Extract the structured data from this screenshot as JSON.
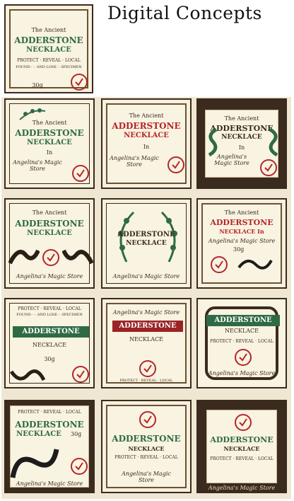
{
  "header": {
    "title": "Digital Concepts"
  },
  "colors": {
    "green": "#2e6b45",
    "red": "#b3262a",
    "dark": "#3a2b1e",
    "paper": "#f7f0dc"
  },
  "sample": {
    "line1": "The Ancient",
    "line2": "ADDERSTONE",
    "line3": "NECKLACE",
    "line4": "PROTECT · REVEAL · LOCAL",
    "line5": "FOUND·· ·· AND LOSE ·· SPECIMEN",
    "weight": "30g"
  },
  "labels": [
    {
      "top": "The Ancient",
      "name": "ADDERSTONE",
      "sub": "NECKLACE",
      "in": "In",
      "maker": "Angelina's Magic Store"
    },
    {
      "top": "The Ancient",
      "name": "ADDERSTONE",
      "sub": "NECKLACE",
      "in": "In",
      "maker": "Angelina's Magic Store"
    },
    {
      "top": "The Ancient",
      "name": "ADDERSTONE",
      "sub": "NECKLACE",
      "in": "In",
      "maker": "Angelina's Magic Store"
    },
    {
      "top": "The Ancient",
      "name": "ADDERSTONE",
      "sub": "NECKLACE",
      "maker": "Angelina's Magic Store"
    },
    {
      "name": "ADDERSTONE",
      "sub": "NECKLACE",
      "maker": "Angelina's Magic Store"
    },
    {
      "top": "The Ancient",
      "name": "ADDERSTONE",
      "sub": "NECKLACE In",
      "maker": "Angelina's Magic Store",
      "weight": "30g"
    },
    {
      "top": "PROTECT · REVEAL · LOCAL",
      "top2": "FOUND·· ·· AND LOSE ·· SPECIMEN",
      "name": "ADDERSTONE",
      "sub": "NECKLACE",
      "weight": "30g"
    },
    {
      "top": "Angelina's Magic Store",
      "name": "ADDERSTONE",
      "sub": "NECKLACE",
      "bottom": "PROTECT · REVEAL · LOCAL"
    },
    {
      "name": "ADDERSTONE",
      "sub": "NECKLACE",
      "bottom": "PROTECT · REVEAL · LOCAL",
      "maker": "Angelina's Magic Store"
    },
    {
      "top": "PROTECT · REVEAL · LOCAL",
      "name": "ADDERSTONE",
      "sub": "NECKLACE",
      "weight": "30g",
      "maker": "Angelina's Magic Store"
    },
    {
      "name": "ADDERSTONE",
      "sub": "NECKLACE",
      "bottom": "PROTECT · REVEAL · LOCAL",
      "maker": "Angelina's Magic Store"
    },
    {
      "name": "ADDERSTONE",
      "sub": "NECKLACE",
      "bottom": "PROTECT · REVEAL · LOCAL",
      "maker": "Angelina's Magic Store"
    }
  ]
}
